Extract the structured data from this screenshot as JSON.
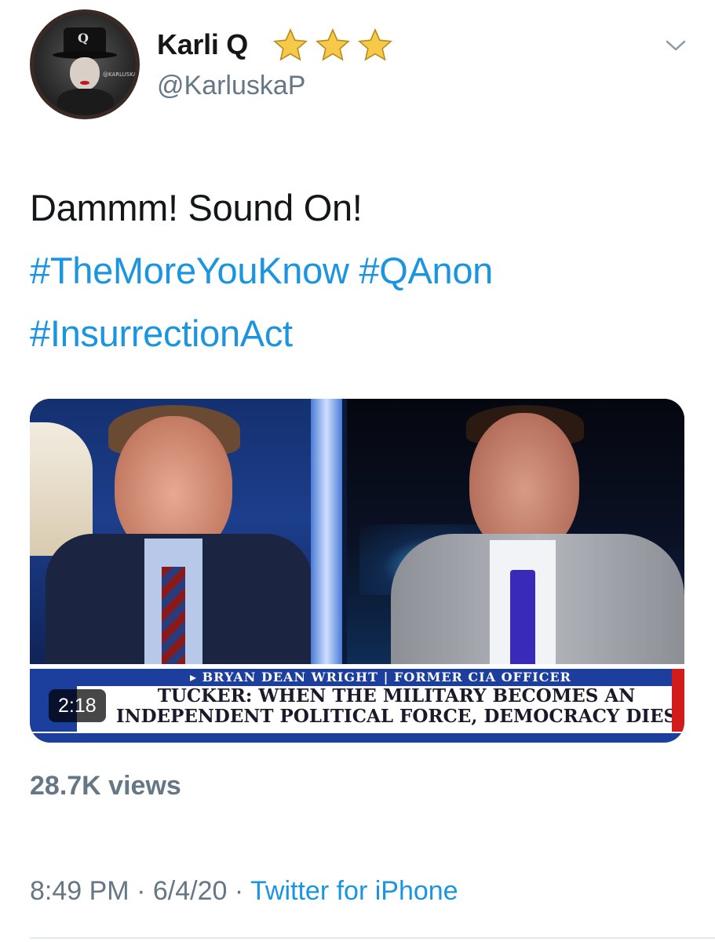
{
  "author": {
    "display_name": "Karli Q",
    "handle": "@KarluskaP",
    "badge_icon": "star-icon",
    "badge_count": 3,
    "avatar_text": "@KARLUSKAP",
    "avatar_letter": "Q"
  },
  "tweet": {
    "text": "Dammm! Sound On!",
    "hashtags": [
      "#TheMoreYouKnow",
      "#QAnon",
      "#InsurrectionAct"
    ]
  },
  "media": {
    "type": "video",
    "duration": "2:18",
    "chyron_top": "▸ BRYAN DEAN WRIGHT | FORMER CIA OFFICER",
    "chyron_line1": "TUCKER: WHEN THE MILITARY BECOMES AN",
    "chyron_line2": "INDEPENDENT POLITICAL FORCE, DEMOCRACY DIES"
  },
  "stats": {
    "views": "28.7K views"
  },
  "meta": {
    "time": "8:49 PM",
    "separator": "·",
    "date": "6/4/20",
    "source": "Twitter for iPhone"
  },
  "colors": {
    "link": "#1b95e0",
    "secondary_text": "#657786",
    "primary_text": "#14171a",
    "star": "#f5c518"
  }
}
